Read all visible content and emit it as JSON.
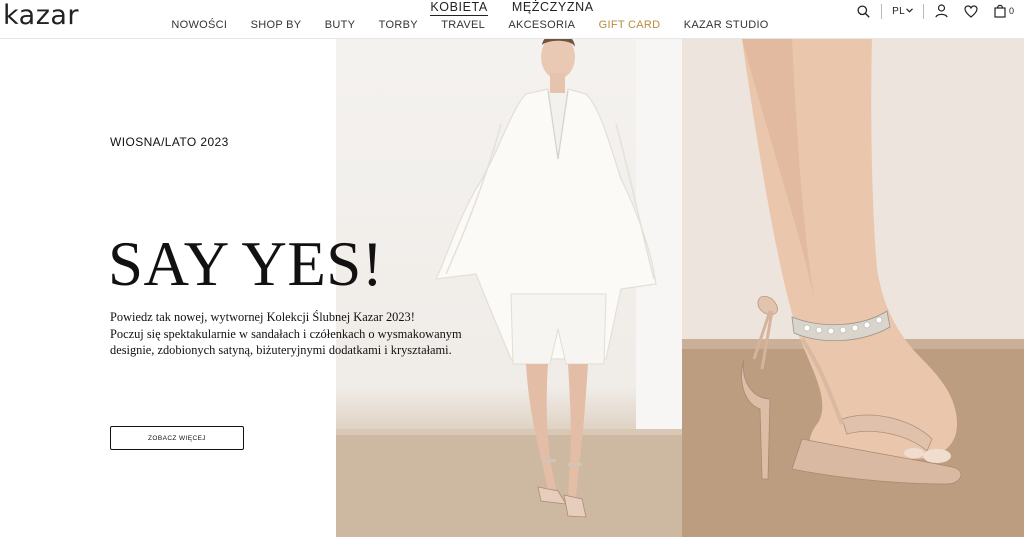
{
  "brand": {
    "logo_text": "kazar"
  },
  "gender_nav": [
    {
      "label": "KOBIETA",
      "active": true
    },
    {
      "label": "MĘŻCZYZNA",
      "active": false
    }
  ],
  "main_nav": [
    {
      "label": "NOWOŚCI"
    },
    {
      "label": "SHOP BY"
    },
    {
      "label": "BUTY"
    },
    {
      "label": "TORBY"
    },
    {
      "label": "TRAVEL"
    },
    {
      "label": "AKCESORIA"
    },
    {
      "label": "GIFT CARD",
      "accent": "#b98b3e"
    },
    {
      "label": "KAZAR STUDIO"
    }
  ],
  "tools": {
    "search_icon": "search-icon",
    "language": "PL",
    "language_icon": "chevron-down-icon",
    "account_icon": "user-icon",
    "wishlist_icon": "heart-icon",
    "cart_icon": "bag-icon",
    "cart_count": "0"
  },
  "hero": {
    "season": "WIOSNA/LATO 2023",
    "headline": "SAY YES!",
    "description": [
      "Powiedz tak nowej, wytwornej Kolekcji Ślubnej Kazar 2023!",
      "Poczuj się spektakularnie w sandałach i czółenkach o wysmakowanym",
      "designie, zdobionych satyną, biżuteryjnymi dodatkami i kryształami."
    ],
    "cta_label": "ZOBACZ WIĘCEJ"
  },
  "colors": {
    "text": "#111111",
    "accent": "#b98b3e",
    "background": "#ffffff"
  }
}
